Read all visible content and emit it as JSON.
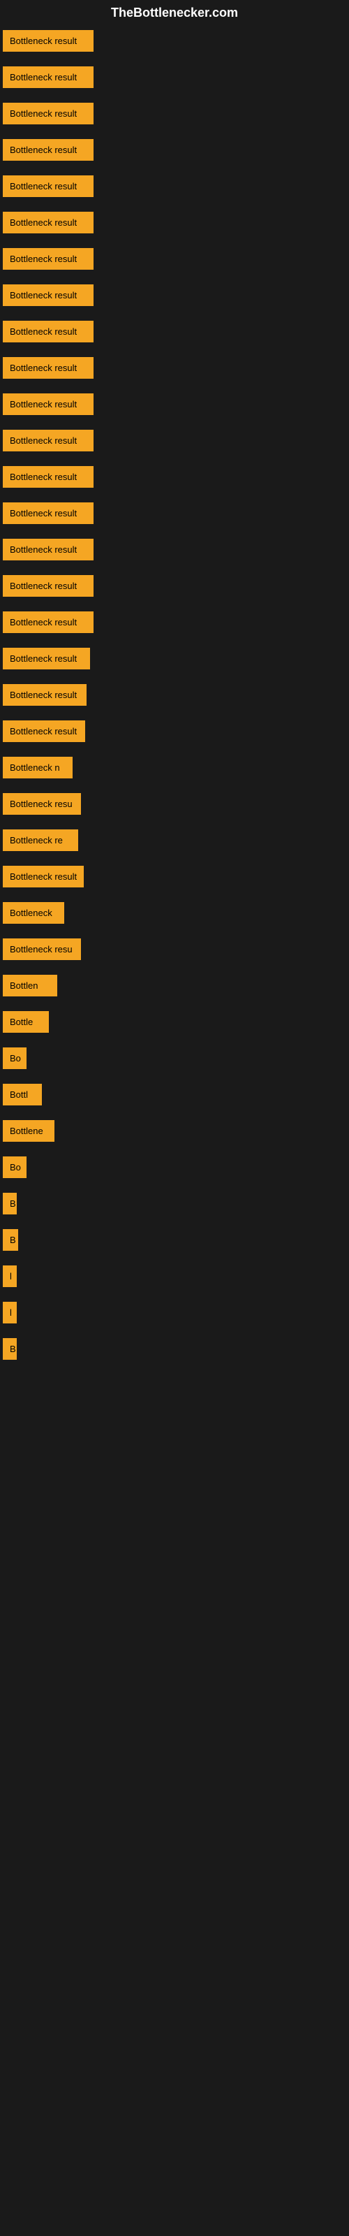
{
  "site": {
    "title": "TheBottlenecker.com"
  },
  "items": [
    {
      "label": "Bottleneck result",
      "width": 130
    },
    {
      "label": "Bottleneck result",
      "width": 130
    },
    {
      "label": "Bottleneck result",
      "width": 130
    },
    {
      "label": "Bottleneck result",
      "width": 130
    },
    {
      "label": "Bottleneck result",
      "width": 130
    },
    {
      "label": "Bottleneck result",
      "width": 130
    },
    {
      "label": "Bottleneck result",
      "width": 130
    },
    {
      "label": "Bottleneck result",
      "width": 130
    },
    {
      "label": "Bottleneck result",
      "width": 130
    },
    {
      "label": "Bottleneck result",
      "width": 130
    },
    {
      "label": "Bottleneck result",
      "width": 130
    },
    {
      "label": "Bottleneck result",
      "width": 130
    },
    {
      "label": "Bottleneck result",
      "width": 130
    },
    {
      "label": "Bottleneck result",
      "width": 130
    },
    {
      "label": "Bottleneck result",
      "width": 130
    },
    {
      "label": "Bottleneck result",
      "width": 130
    },
    {
      "label": "Bottleneck result",
      "width": 130
    },
    {
      "label": "Bottleneck result",
      "width": 125
    },
    {
      "label": "Bottleneck result",
      "width": 120
    },
    {
      "label": "Bottleneck result",
      "width": 118
    },
    {
      "label": "Bottleneck n",
      "width": 100
    },
    {
      "label": "Bottleneck resu",
      "width": 112
    },
    {
      "label": "Bottleneck re",
      "width": 108
    },
    {
      "label": "Bottleneck result",
      "width": 116
    },
    {
      "label": "Bottleneck",
      "width": 88
    },
    {
      "label": "Bottleneck resu",
      "width": 112
    },
    {
      "label": "Bottlen",
      "width": 78
    },
    {
      "label": "Bottle",
      "width": 66
    },
    {
      "label": "Bo",
      "width": 34
    },
    {
      "label": "Bottl",
      "width": 56
    },
    {
      "label": "Bottlene",
      "width": 74
    },
    {
      "label": "Bo",
      "width": 34
    },
    {
      "label": "B",
      "width": 20
    },
    {
      "label": "B",
      "width": 22
    },
    {
      "label": "l",
      "width": 10
    },
    {
      "label": "l",
      "width": 10
    },
    {
      "label": "B",
      "width": 20
    }
  ]
}
